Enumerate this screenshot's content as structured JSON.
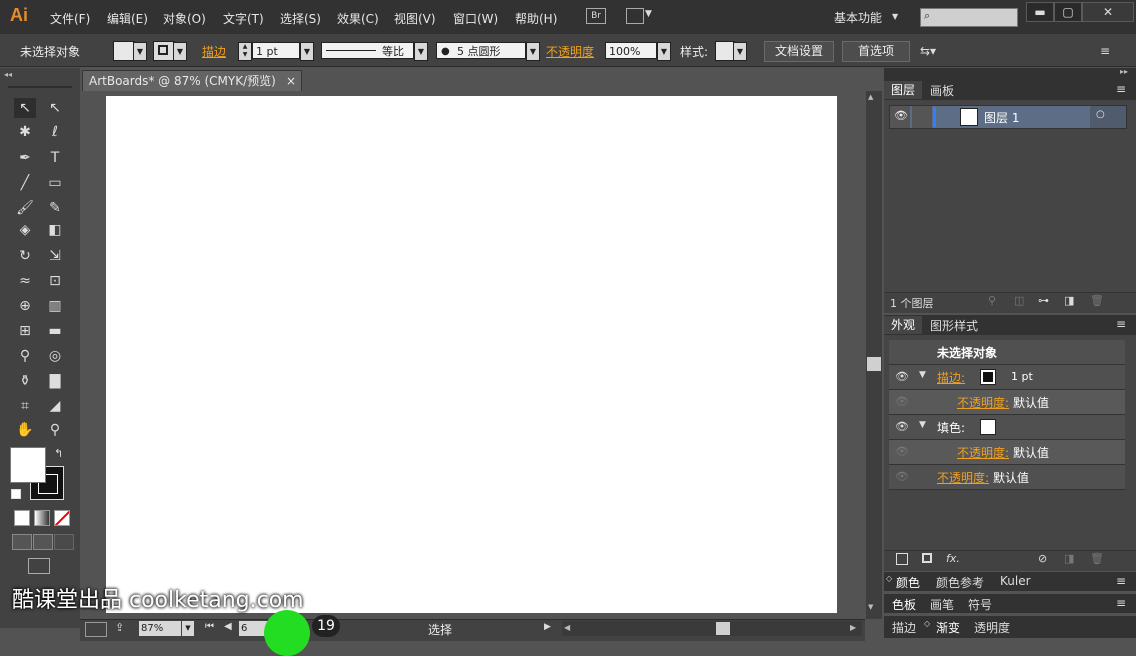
{
  "app": {
    "logo": "Ai",
    "workspace": "基本功能",
    "br": "Br"
  },
  "menu": [
    "文件(F)",
    "编辑(E)",
    "对象(O)",
    "文字(T)",
    "选择(S)",
    "效果(C)",
    "视图(V)",
    "窗口(W)",
    "帮助(H)"
  ],
  "control": {
    "selection": "未选择对象",
    "stroke_label": "描边",
    "stroke_value": "1 pt",
    "profile": "等比",
    "brush": "5 点圆形",
    "opacity_label": "不透明度",
    "opacity_value": "100%",
    "style_label": "样式:",
    "doc_settings": "文档设置",
    "preferences": "首选项"
  },
  "document": {
    "tab": "ArtBoards* @ 87% (CMYK/预览)",
    "close": "×"
  },
  "status": {
    "zoom": "87%",
    "artboard": "6",
    "tool": "选择"
  },
  "layers": {
    "tabs": [
      "图层",
      "画板"
    ],
    "items": [
      {
        "name": "图层 1"
      }
    ],
    "count": "1 个图层"
  },
  "appearance": {
    "tabs": [
      "外观",
      "图形样式"
    ],
    "title": "未选择对象",
    "stroke_label": "描边:",
    "stroke_value": "1 pt",
    "stroke_opacity_label": "不透明度:",
    "stroke_opacity_value": "默认值",
    "fill_label": "填色:",
    "fill_opacity_label": "不透明度:",
    "fill_opacity_value": "默认值",
    "opacity_label": "不透明度:",
    "opacity_value": "默认值",
    "fx": "fx."
  },
  "color_panel": {
    "tabs": [
      "颜色",
      "颜色参考",
      "Kuler"
    ]
  },
  "swatch_panel": {
    "tabs": [
      "色板",
      "画笔",
      "符号"
    ]
  },
  "stroke_panel": {
    "tabs": [
      "描边",
      "渐变",
      "透明度"
    ]
  },
  "overlay": {
    "watermark": "酷课堂出品 coolketang.com",
    "step": "19"
  }
}
